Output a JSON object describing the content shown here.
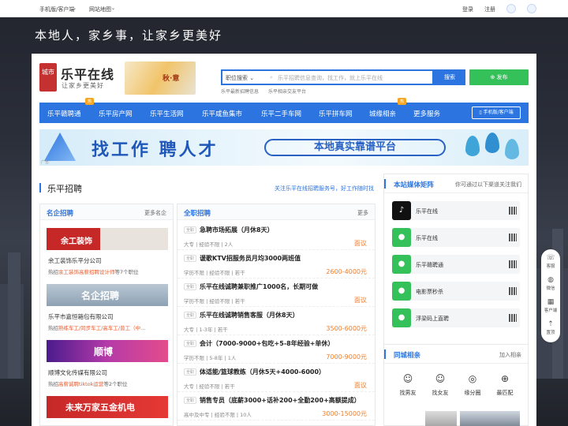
{
  "topbar": {
    "mobile": "手机版/客户端",
    "sitemap": "网站地图",
    "login": "登录",
    "register": "注册"
  },
  "slogan": "本地人，家乡事，让家乡更美好",
  "logo": {
    "badge": "城市",
    "name": "乐平在线",
    "tagline": "让家乡更美好",
    "autumn": "秋·意"
  },
  "search": {
    "category": "职位搜索",
    "placeholder": "乐平招聘信息查询，找工作，就上乐平在线",
    "button": "搜索",
    "publish": "发布"
  },
  "hot_links": [
    "乐平最新招聘信息",
    "乐平相亲交友平台"
  ],
  "nav": {
    "items": [
      "乐平赣聘通",
      "乐平房产网",
      "乐平生活网",
      "乐平咸鱼集市",
      "乐平二手车网",
      "乐平拼车网",
      "城缘相亲",
      "更多服务"
    ],
    "badge": "热",
    "mobile": "手机版/客户端"
  },
  "banner": {
    "main": "找工作 聘人才",
    "pill": "本地真实靠谱平台",
    "ad": "广告"
  },
  "recruit": {
    "title": "乐平招聘",
    "more": "关注乐平在线招聘服务号，好工作随时找"
  },
  "famous": {
    "title": "名企招聘",
    "more": "更多名企",
    "companies": [
      {
        "banner": "余工装饰",
        "name": "余工装饰乐平分公司",
        "hot_prefix": "热招",
        "hot_job": "余工装饰高薪招聘设计师",
        "hot_suffix": "等7个职位"
      },
      {
        "banner": "名企招聘",
        "name": "乐平市嘉恒箱包有限公司",
        "hot_prefix": "热招",
        "hot_job": "熟练车工/同步车工/高车工/普工（中…",
        "hot_suffix": ""
      },
      {
        "banner": "顺博",
        "name": "顺博文化传媒有限公司",
        "hot_prefix": "热招",
        "hot_job": "高薪诚聘tiktok运营",
        "hot_suffix": "等2个职位"
      },
      {
        "banner": "未来万家五金机电",
        "name": "",
        "hot_prefix": "",
        "hot_job": "",
        "hot_suffix": ""
      }
    ]
  },
  "jobs": {
    "title": "全职招聘",
    "more": "更多",
    "tag": "全职",
    "list": [
      {
        "title": "急聘市场拓展（月休8天）",
        "desc": "大专 | 经验不限 | 2人",
        "salary": "面议"
      },
      {
        "title": "谖歌KTV招服务员月均3000两班值",
        "desc": "学历不限 | 经验不限 | 若干",
        "salary": "2600-4000元"
      },
      {
        "title": "乐平在线诚聘兼职推广1000名，长期可做",
        "desc": "学历不限 | 经验不限 | 若干",
        "salary": "面议"
      },
      {
        "title": "乐平在线诚聘销售客服（月休8天）",
        "desc": "大专 | 1-3年 | 若干",
        "salary": "3500-6000元"
      },
      {
        "title": "会计（7000-9000+包吃+5-8年经验+单休）",
        "desc": "学历不限 | 5-8年 | 1人",
        "salary": "7000-9000元"
      },
      {
        "title": "体适能/篮球教练（月休5天+4000-6000）",
        "desc": "大专 | 经验不限 | 若干",
        "salary": "面议"
      },
      {
        "title": "销售专员（底薪3000+话补200+全勤200+高额提成）",
        "desc": "高中及中专 | 经验不限 | 10人",
        "salary": "3000-15000元"
      }
    ]
  },
  "media": {
    "title": "本站媒体矩阵",
    "more": "你可通过以下渠道关注我们",
    "items": [
      {
        "name": "乐平在线",
        "icon": "tiktok-icon",
        "color": "#111111"
      },
      {
        "name": "乐平在线",
        "icon": "wechat-icon",
        "color": "#35c15a"
      },
      {
        "name": "乐平赣聘通",
        "icon": "wechat-icon",
        "color": "#35c15a"
      },
      {
        "name": "电影票秒杀",
        "icon": "wechat-icon",
        "color": "#35c15a"
      },
      {
        "name": "浮梁码上直聘",
        "icon": "wechat-icon",
        "color": "#35c15a"
      }
    ]
  },
  "dating": {
    "title": "同城相亲",
    "more": "加入相亲",
    "items": [
      "找男友",
      "找女友",
      "缘分圈",
      "最匹配"
    ]
  },
  "sidebar": {
    "items": [
      "客服",
      "微信",
      "客户端",
      "置顶"
    ]
  }
}
